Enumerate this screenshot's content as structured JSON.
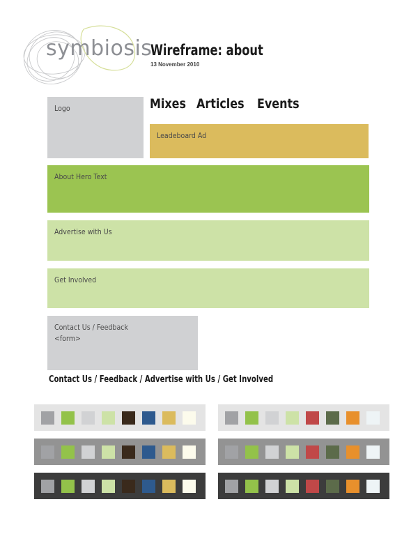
{
  "header": {
    "brand": "symbiosis",
    "title": "Wireframe: about",
    "date": "13 November 2010"
  },
  "nav": {
    "items": [
      "Mixes",
      "Articles",
      "Events"
    ]
  },
  "blocks": {
    "logo": "Logo",
    "ad": "Leadeboard Ad",
    "hero": "About Hero Text",
    "advertise": "Advertise with Us",
    "involved": "Get Involved",
    "contact": "Contact Us  /  Feedback",
    "form": "<form>"
  },
  "footer": {
    "links": "Contact Us  /  Feedback  /  Advertise with Us  /  Get Involved"
  },
  "palettes": {
    "left": [
      "#a1a2a5",
      "#93c24a",
      "#d1d2d4",
      "#cde2a7",
      "#3a2a1c",
      "#2e5a8e",
      "#dbbb5d",
      "#fcfbec"
    ],
    "right": [
      "#a1a2a5",
      "#93c24a",
      "#d1d2d4",
      "#cde2a7",
      "#c04848",
      "#5c6b4a",
      "#e8902c",
      "#eef4f6"
    ],
    "backgrounds": [
      "#e4e4e4",
      "#939393",
      "#3c3c3c"
    ]
  }
}
